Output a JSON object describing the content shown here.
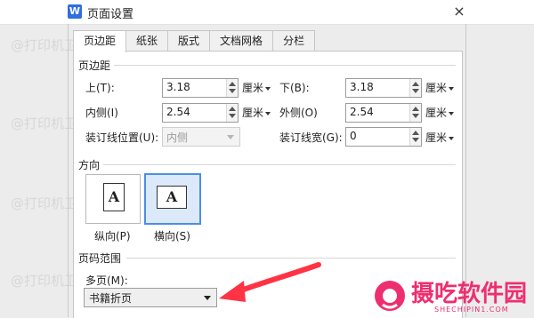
{
  "window": {
    "app_logo": "W",
    "title": "页面设置",
    "close_symbol": "×"
  },
  "tabs": [
    {
      "label": "页边距",
      "active": true
    },
    {
      "label": "纸张",
      "active": false
    },
    {
      "label": "版式",
      "active": false
    },
    {
      "label": "文档网格",
      "active": false
    },
    {
      "label": "分栏",
      "active": false
    }
  ],
  "margins": {
    "section_title": "页边距",
    "top": {
      "label": "上(T):",
      "value": "3.18",
      "unit": "厘米"
    },
    "bottom": {
      "label": "下(B):",
      "value": "3.18",
      "unit": "厘米"
    },
    "inside": {
      "label": "内侧(I)",
      "value": "2.54",
      "unit": "厘米"
    },
    "outside": {
      "label": "外侧(O)",
      "value": "2.54",
      "unit": "厘米"
    },
    "gutter_position": {
      "label": "装订线位置(U):",
      "value": "内侧"
    },
    "gutter_width": {
      "label": "装订线宽(G):",
      "value": "0",
      "unit": "厘米"
    }
  },
  "orientation": {
    "section_title": "方向",
    "portrait": {
      "label": "纵向(P)",
      "glyph": "A"
    },
    "landscape": {
      "label": "横向(S)",
      "glyph": "A",
      "selected": true
    }
  },
  "page_range": {
    "section_title": "页码范围",
    "multiple_pages_label": "多页(M):",
    "multiple_pages_value": "书籍折页"
  },
  "watermark_text": "@打印机卫士",
  "brand": {
    "name": "摄吃软件园",
    "url": "SHECHIPIN1.COM",
    "accent_color": "#ee2f6f"
  },
  "arrow_color": "#ff3344"
}
